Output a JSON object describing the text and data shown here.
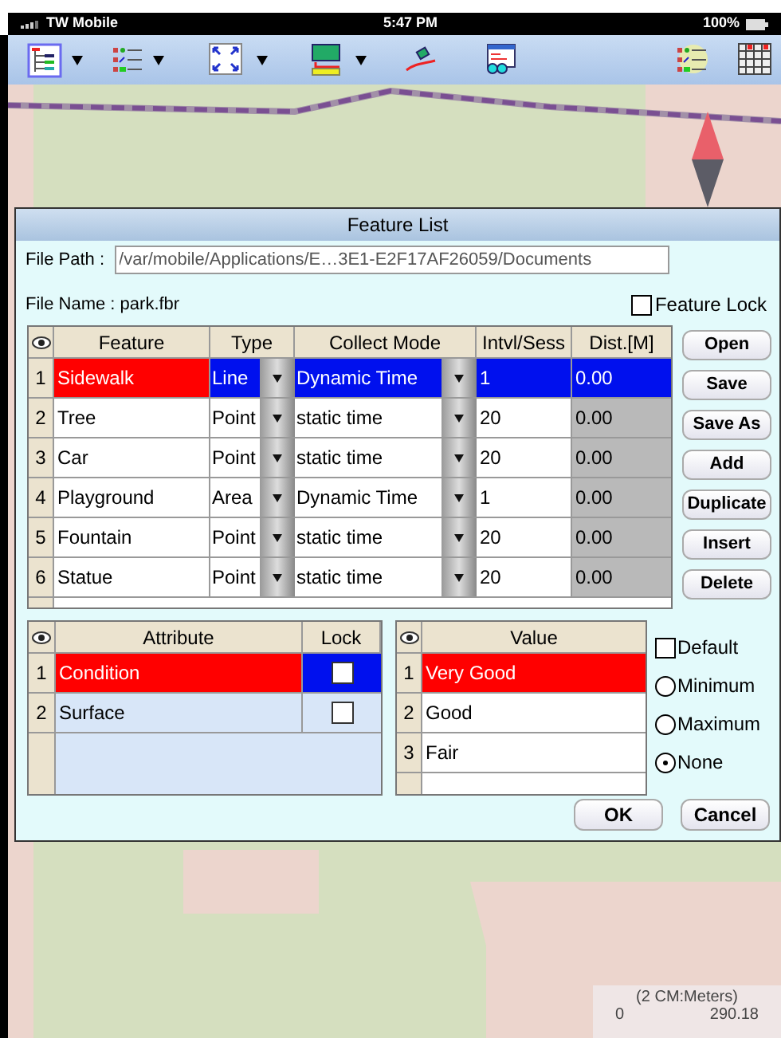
{
  "status_bar": {
    "carrier": "TW Mobile",
    "time": "5:47 PM",
    "battery": "100%"
  },
  "map": {
    "scale": {
      "label": "(2 CM:Meters)",
      "min": "0",
      "max": "290.18"
    }
  },
  "dialog": {
    "title": "Feature List",
    "file_path": {
      "label": "File Path :",
      "value": "/var/mobile/Applications/E…3E1-E2F17AF26059/Documents"
    },
    "file_name": "File Name : park.fbr",
    "feature_lock": {
      "label": "Feature Lock",
      "checked": false
    },
    "feature_table": {
      "columns": [
        "Feature",
        "Type",
        "Collect Mode",
        "Intvl/Sess",
        "Dist.[M]"
      ],
      "rows": [
        {
          "index": "1",
          "feature": "Sidewalk",
          "type": "Line",
          "collect_mode": "Dynamic Time",
          "interval": "1",
          "distance": "0.00",
          "selected": true
        },
        {
          "index": "2",
          "feature": "Tree",
          "type": "Point",
          "collect_mode": "static time",
          "interval": "20",
          "distance": "0.00",
          "selected": false
        },
        {
          "index": "3",
          "feature": "Car",
          "type": "Point",
          "collect_mode": "static time",
          "interval": "20",
          "distance": "0.00",
          "selected": false
        },
        {
          "index": "4",
          "feature": "Playground",
          "type": "Area",
          "collect_mode": "Dynamic Time",
          "interval": "1",
          "distance": "0.00",
          "selected": false
        },
        {
          "index": "5",
          "feature": "Fountain",
          "type": "Point",
          "collect_mode": "static time",
          "interval": "20",
          "distance": "0.00",
          "selected": false
        },
        {
          "index": "6",
          "feature": "Statue",
          "type": "Point",
          "collect_mode": "static time",
          "interval": "20",
          "distance": "0.00",
          "selected": false
        }
      ]
    },
    "side_buttons": [
      "Open",
      "Save",
      "Save As",
      "Add",
      "Duplicate",
      "Insert",
      "Delete"
    ],
    "attribute_table": {
      "columns": [
        "Attribute",
        "Lock"
      ],
      "rows": [
        {
          "index": "1",
          "name": "Condition",
          "locked": false,
          "selected": true
        },
        {
          "index": "2",
          "name": "Surface",
          "locked": false,
          "selected": false
        }
      ]
    },
    "value_table": {
      "columns": [
        "Value"
      ],
      "rows": [
        {
          "index": "1",
          "value": "Very Good",
          "selected": true
        },
        {
          "index": "2",
          "value": "Good",
          "selected": false
        },
        {
          "index": "3",
          "value": "Fair",
          "selected": false
        }
      ]
    },
    "default_option": {
      "label": "Default",
      "checked": false
    },
    "options": [
      {
        "label": "Minimum",
        "selected": false
      },
      {
        "label": "Maximum",
        "selected": false
      },
      {
        "label": "None",
        "selected": true
      }
    ],
    "footer_buttons": [
      "OK",
      "Cancel"
    ]
  }
}
